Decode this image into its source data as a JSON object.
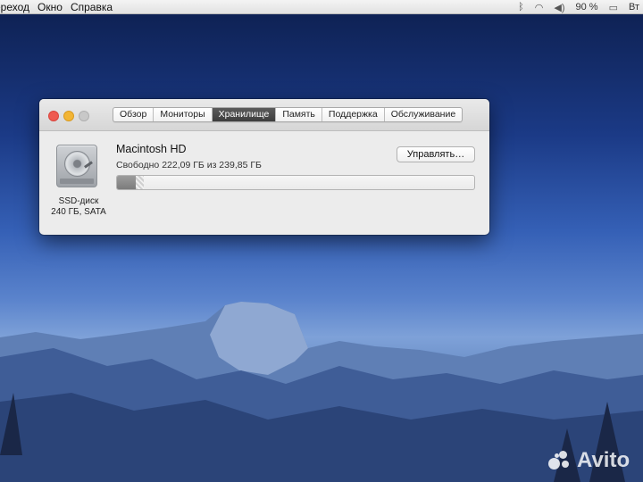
{
  "menubar": {
    "items": [
      "ереход",
      "Окно",
      "Справка"
    ],
    "battery": "90 %",
    "extra": "Вт"
  },
  "window": {
    "tabs": [
      {
        "label": "Обзор",
        "active": false
      },
      {
        "label": "Мониторы",
        "active": false
      },
      {
        "label": "Хранилище",
        "active": true
      },
      {
        "label": "Память",
        "active": false
      },
      {
        "label": "Поддержка",
        "active": false
      },
      {
        "label": "Обслуживание",
        "active": false
      }
    ],
    "disk": {
      "name": "Macintosh HD",
      "free_text": "Свободно 222,09 ГБ из 239,85 ГБ",
      "type_line1": "SSD-диск",
      "type_line2": "240 ГБ, SATA",
      "used_fraction": 0.052,
      "other_fraction": 0.022
    },
    "manage_label": "Управлять…"
  },
  "watermark": {
    "text": "Avito"
  },
  "colors": {
    "close": "#ef5a50",
    "minimize": "#f2b535",
    "zoom_disabled": "#c8c8c8",
    "active_tab": "#4a4a4a"
  }
}
